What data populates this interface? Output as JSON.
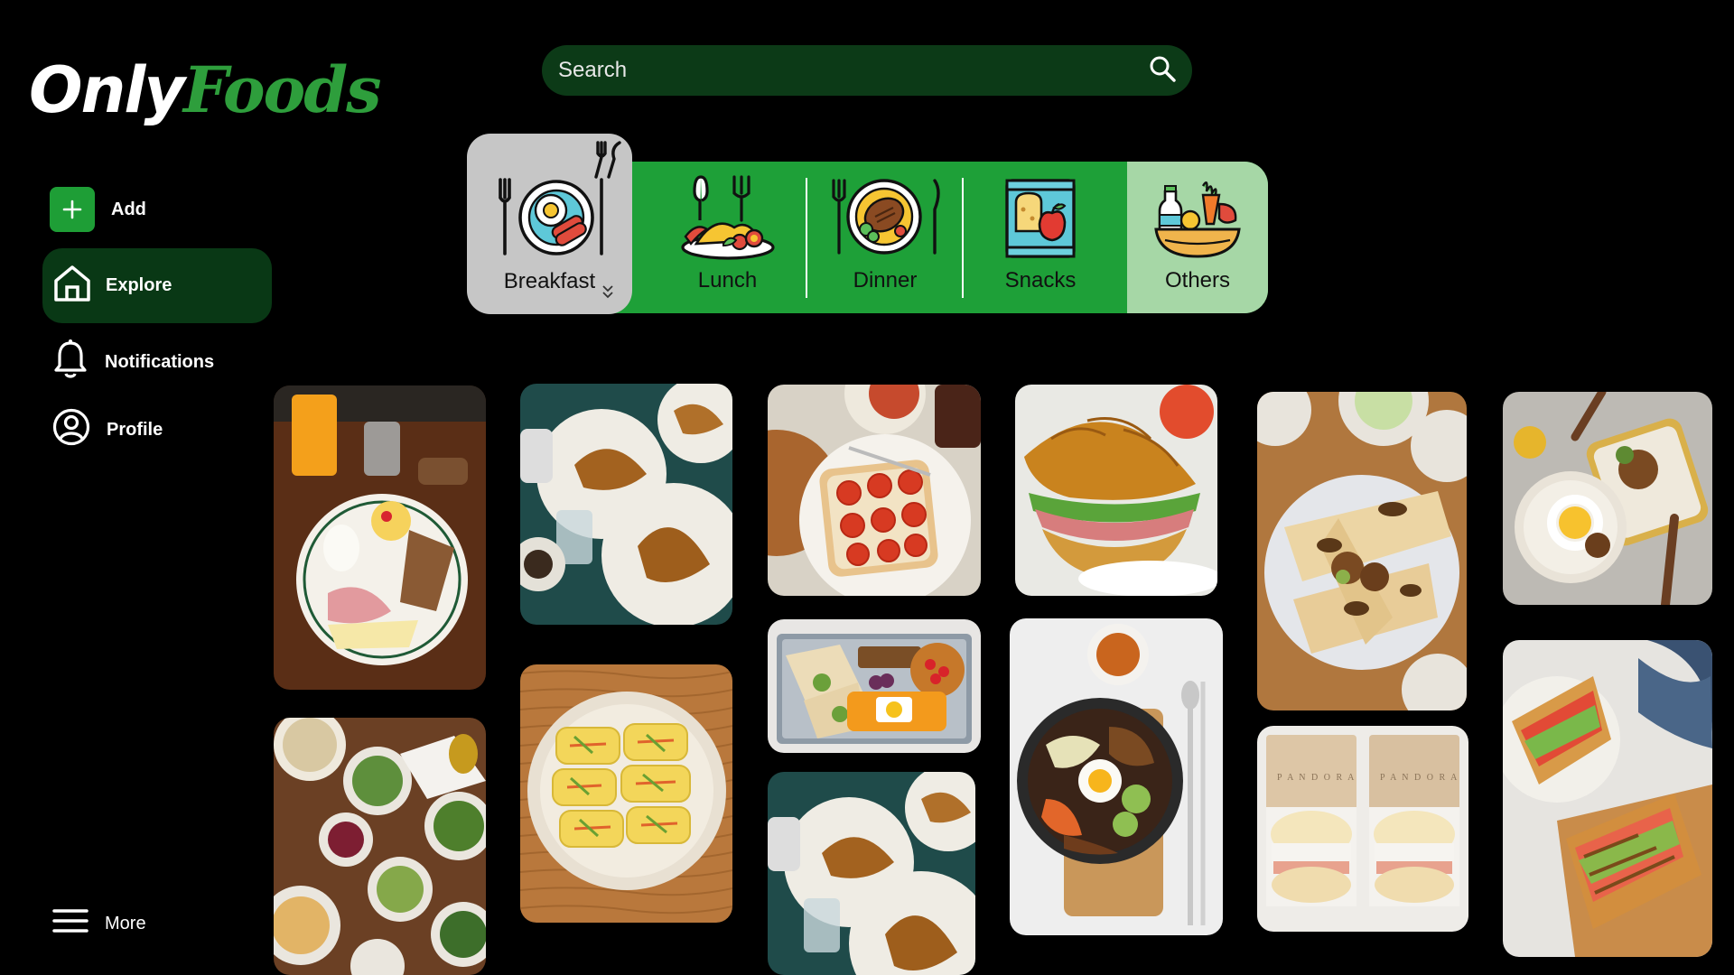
{
  "logo": {
    "part1": "Only",
    "part2": "Foods"
  },
  "sidebar": {
    "add": "Add",
    "explore": "Explore",
    "notifications": "Notifications",
    "profile": "Profile",
    "more": "More"
  },
  "search": {
    "placeholder": "Search"
  },
  "categories": [
    {
      "label": "Breakfast",
      "selected": true
    },
    {
      "label": "Lunch"
    },
    {
      "label": "Dinner"
    },
    {
      "label": "Snacks"
    },
    {
      "label": "Others"
    }
  ],
  "colors": {
    "accent": "#1ea038",
    "accent_dark": "#093815",
    "search_bg": "#0c3a17",
    "selected_tab": "#c6c6c6",
    "others_tab": "#a6d7a6"
  },
  "photos": [
    {
      "name": "breakfast-platter"
    },
    {
      "name": "croissants-cafe"
    },
    {
      "name": "tomato-toast"
    },
    {
      "name": "croissant-sandwich"
    },
    {
      "name": "grilled-burritos"
    },
    {
      "name": "rice-bowls"
    },
    {
      "name": "salad-table"
    },
    {
      "name": "rolled-omelette"
    },
    {
      "name": "wrap-lunchbox"
    },
    {
      "name": "bibimbap"
    },
    {
      "name": "pandora-burgers"
    },
    {
      "name": "pressed-sandwich"
    },
    {
      "name": "croissants-cafe-2"
    }
  ]
}
